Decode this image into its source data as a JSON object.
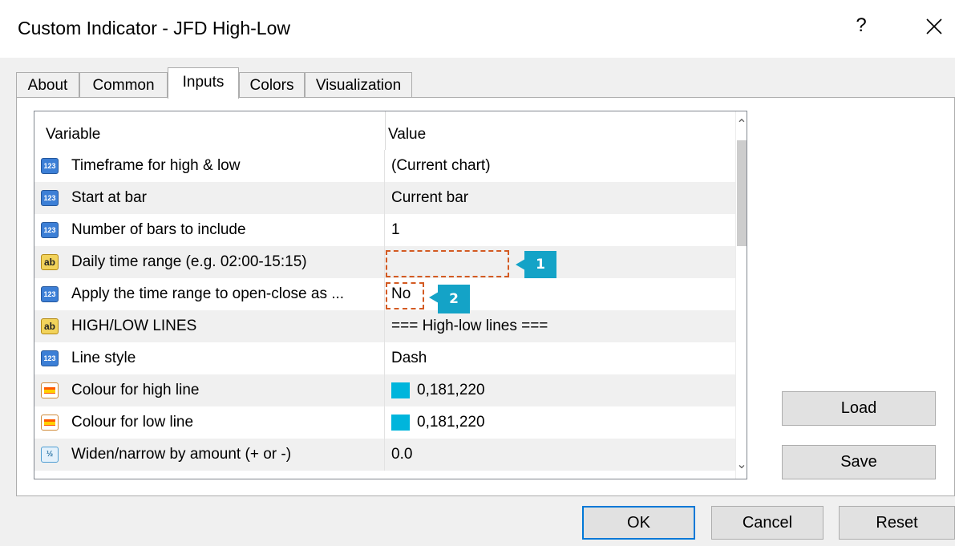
{
  "window": {
    "title": "Custom Indicator - JFD High-Low",
    "help_label": "?"
  },
  "tabs": [
    {
      "label": "About"
    },
    {
      "label": "Common"
    },
    {
      "label": "Inputs",
      "active": true
    },
    {
      "label": "Colors"
    },
    {
      "label": "Visualization"
    }
  ],
  "grid": {
    "col_variable": "Variable",
    "col_value": "Value",
    "rows": [
      {
        "icon": "123",
        "variable": "Timeframe for high & low",
        "value": "(Current chart)"
      },
      {
        "icon": "123",
        "variable": "Start at bar",
        "value": "Current bar"
      },
      {
        "icon": "123",
        "variable": "Number of bars to include",
        "value": "1"
      },
      {
        "icon": "ab",
        "variable": "Daily time range (e.g. 02:00-15:15)",
        "value": ""
      },
      {
        "icon": "123",
        "variable": "Apply the time range to open-close as ...",
        "value": "No"
      },
      {
        "icon": "ab",
        "variable": "HIGH/LOW LINES",
        "value": "=== High-low lines ==="
      },
      {
        "icon": "123",
        "variable": "Line style",
        "value": "Dash"
      },
      {
        "icon": "color",
        "variable": "Colour for high line",
        "value": "0,181,220",
        "swatch_color": "#00b5dc"
      },
      {
        "icon": "color",
        "variable": "Colour for low line",
        "value": "0,181,220",
        "swatch_color": "#00b5dc"
      },
      {
        "icon": "1/2",
        "variable": "Widen/narrow by amount (+ or -)",
        "value": "0.0"
      }
    ]
  },
  "callouts": [
    {
      "number": "1"
    },
    {
      "number": "2"
    }
  ],
  "buttons": {
    "load": "Load",
    "save": "Save",
    "ok": "OK",
    "cancel": "Cancel",
    "reset": "Reset"
  },
  "colors": {
    "accent": "#14a3c7",
    "callout_border": "#d35a22",
    "swatch": "#00b5dc"
  }
}
